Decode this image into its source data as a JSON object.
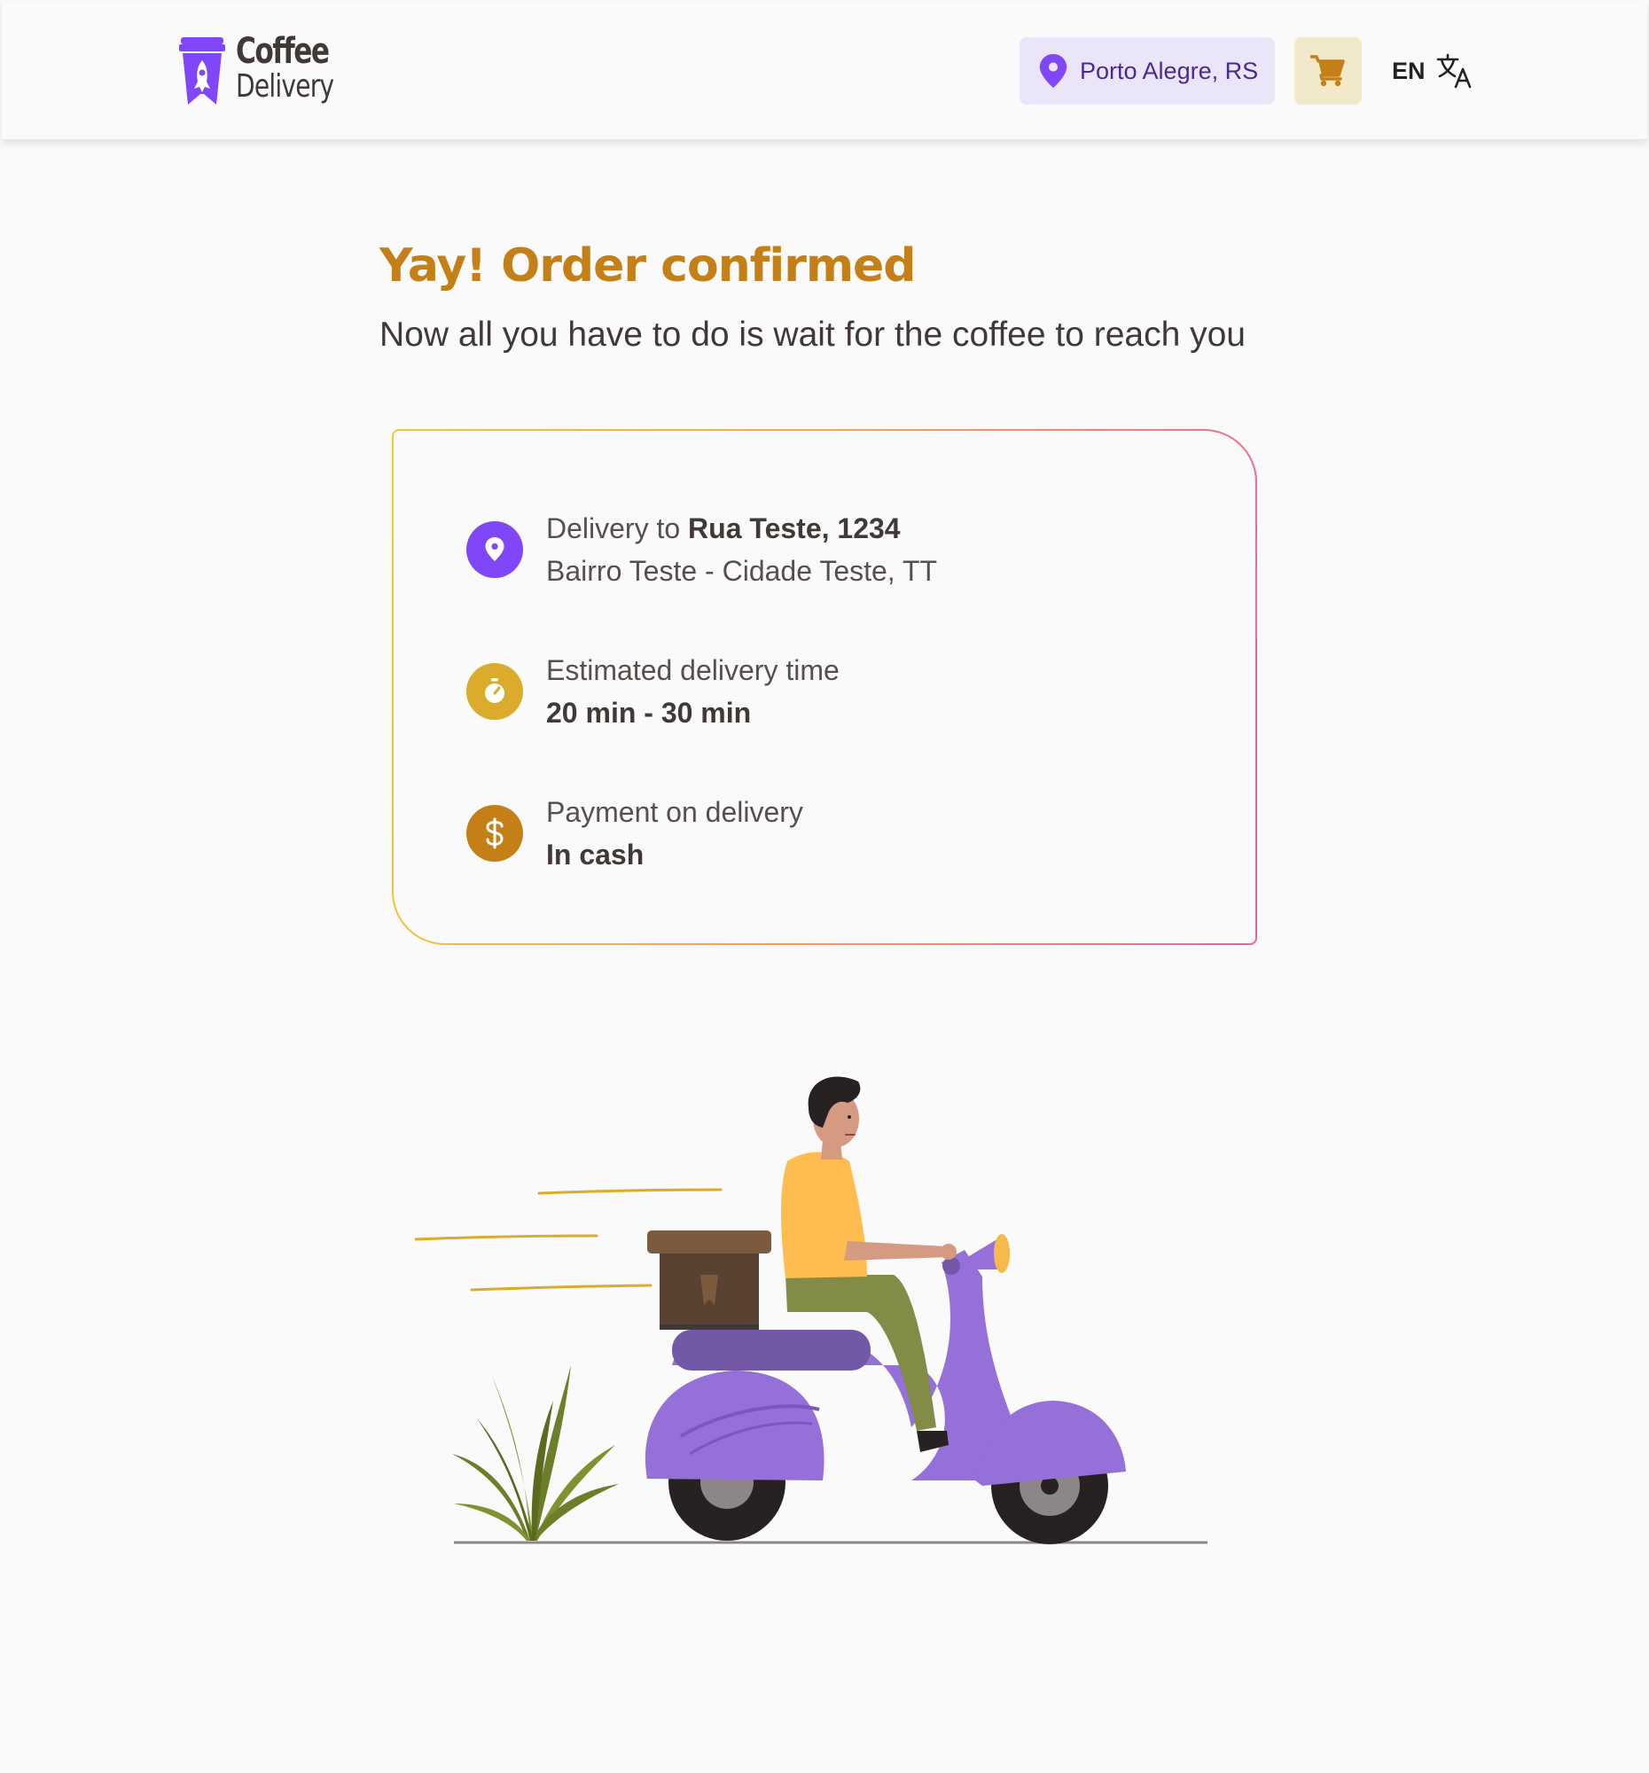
{
  "header": {
    "logo": {
      "word1": "Coffee",
      "word2": "Delivery",
      "icon": "coffee-cup-rocket-icon"
    },
    "location": {
      "label": "Porto Alegre, RS",
      "icon": "map-pin-icon"
    },
    "cart": {
      "icon": "shopping-cart-icon"
    },
    "language": {
      "label": "EN",
      "icon": "translate-icon"
    }
  },
  "main": {
    "title": "Yay! Order confirmed",
    "subtitle": "Now all you have to do is wait for the coffee to reach you",
    "card": {
      "address": {
        "icon": "map-pin-icon",
        "prefix": "Delivery to",
        "street": "Rua Teste, 1234",
        "district": "Bairro Teste - Cidade Teste, TT"
      },
      "time": {
        "icon": "timer-icon",
        "label": "Estimated delivery time",
        "value": "20 min - 30 min"
      },
      "payment": {
        "icon": "currency-dollar-icon",
        "label": "Payment on delivery",
        "value": "In cash"
      }
    },
    "illustration": {
      "icon": "delivery-scooter-illustration"
    }
  },
  "colors": {
    "purple": "#8047f8",
    "purple_light": "#ebe5f9",
    "purple_dark": "#4b2995",
    "yellow": "#dbac2c",
    "yellow_dark": "#c47f17",
    "yellow_light": "#f1e9c9",
    "gradient_start": "#f1c933",
    "gradient_end": "#e9649b",
    "background": "#fafafa"
  }
}
